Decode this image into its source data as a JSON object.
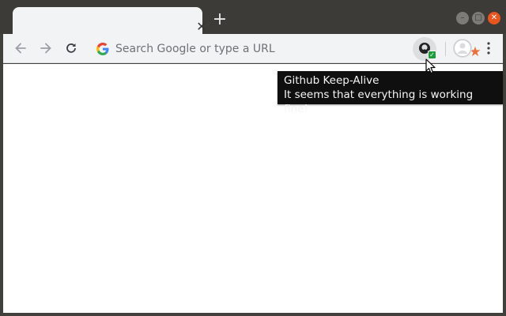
{
  "tab": {
    "title": "",
    "close_glyph": "✕"
  },
  "tabbar": {
    "new_tab_glyph": "+"
  },
  "window_controls": {
    "minimize_glyph": "–",
    "maximize_glyph": "□",
    "close_glyph": "✕"
  },
  "toolbar": {
    "omnibox_placeholder": "Search Google or type a URL",
    "omnibox_value": ""
  },
  "extension": {
    "name": "Github Keep-Alive",
    "status_badge": "✓"
  },
  "tooltip": {
    "title": "Github Keep-Alive",
    "message": "It seems that everything is working fine!"
  },
  "icons": {
    "back": "arrow-left-icon",
    "forward": "arrow-right-icon",
    "reload": "reload-icon",
    "google": "google-g-icon",
    "bookmark": "star-icon",
    "extension": "github-icon",
    "profile": "avatar-icon",
    "menu": "more-vertical-icon"
  },
  "colors": {
    "titlebar": "#3c3b37",
    "toolbar": "#f1f3f4",
    "close_button": "#e9541f",
    "bookmark_star": "#e8703a",
    "extension_badge": "#1e9e3a",
    "tooltip_bg": "#0f0f0f"
  }
}
